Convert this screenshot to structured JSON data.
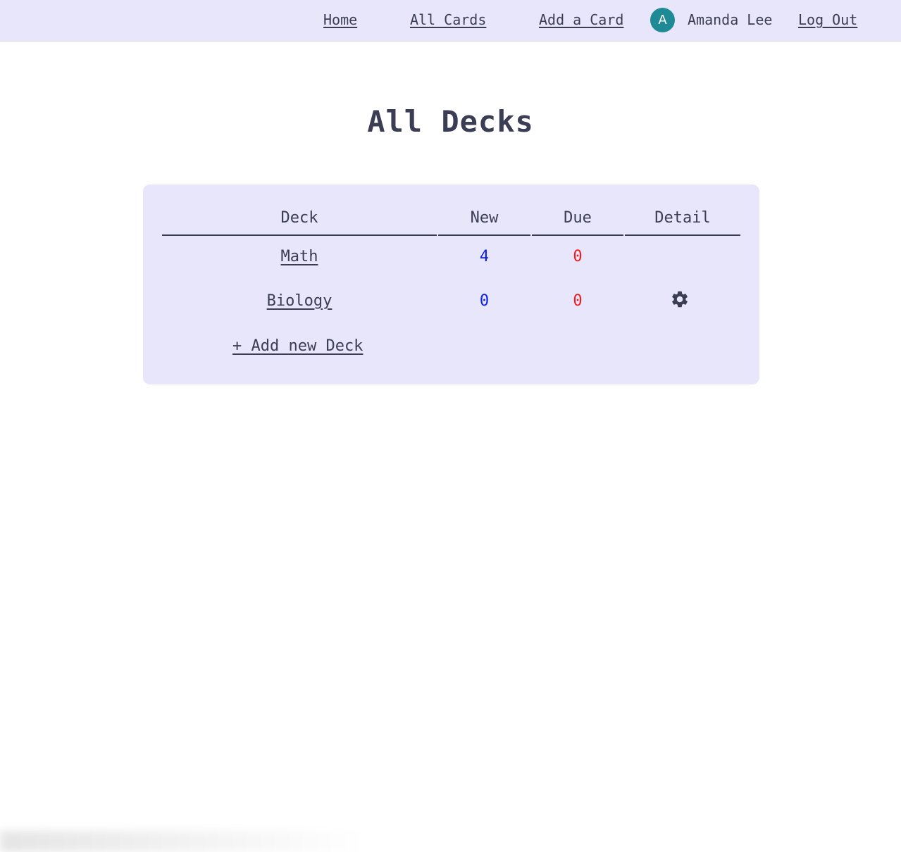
{
  "nav": {
    "links": [
      "Home",
      "All Cards",
      "Add a Card"
    ],
    "avatar_initial": "A",
    "user_name": "Amanda Lee",
    "logout_label": "Log Out"
  },
  "page": {
    "title": "All Decks"
  },
  "table": {
    "headers": [
      "Deck",
      "New",
      "Due",
      "Detail"
    ],
    "rows": [
      {
        "deck": "Math",
        "new": "4",
        "due": "0",
        "detail_icon": ""
      },
      {
        "deck": "Biology",
        "new": "0",
        "due": "0",
        "detail_icon": "gear-icon"
      }
    ],
    "add_label": "+ Add new Deck"
  },
  "colors": {
    "nav_bg": "#e8e6fb",
    "panel_bg": "#e8e6fb",
    "text": "#3b3d55",
    "new_count": "#0a1cf0",
    "due_count": "#f01c1c",
    "avatar_bg": "#1e8a96"
  }
}
